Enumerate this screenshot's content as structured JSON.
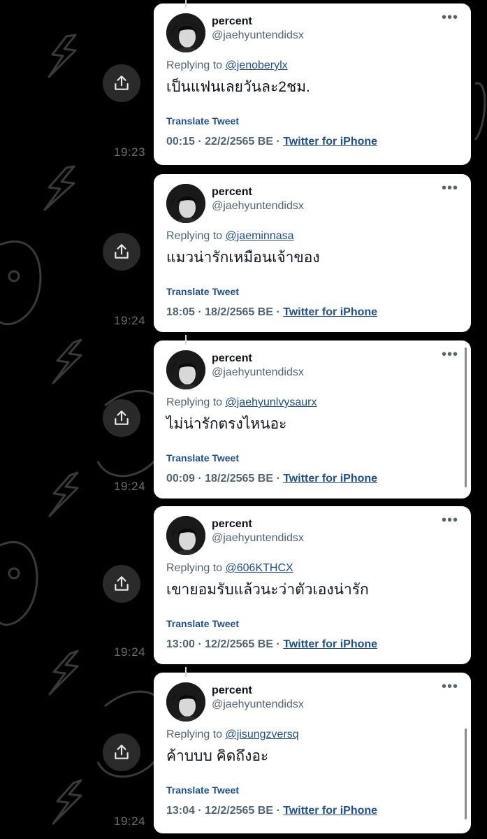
{
  "tweets": [
    {
      "display_name": "percent",
      "handle": "@jaehyuntendidsx",
      "replying_prefix": "Replying to",
      "replying_to": "@jenoberylx",
      "text": "เป็นแฟนเลยวันละ2ชม.",
      "translate": "Translate Tweet",
      "timestamp": "00:15 · 22/2/2565 BE ·",
      "source": "Twitter for iPhone",
      "side_time": "19:23"
    },
    {
      "display_name": "percent",
      "handle": "@jaehyuntendidsx",
      "replying_prefix": "Replying to",
      "replying_to": "@jaeminnasa",
      "text": "แมวน่ารักเหมือนเจ้าของ",
      "translate": "Translate Tweet",
      "timestamp": "18:05 · 18/2/2565 BE ·",
      "source": "Twitter for iPhone",
      "side_time": "19:24"
    },
    {
      "display_name": "percent",
      "handle": "@jaehyuntendidsx",
      "replying_prefix": "Replying to",
      "replying_to": "@jaehyunlvysaurx",
      "text": "ไม่น่ารักตรงไหนอะ",
      "translate": "Translate Tweet",
      "timestamp": "00:09 · 18/2/2565 BE ·",
      "source": "Twitter for iPhone",
      "side_time": "19:24"
    },
    {
      "display_name": "percent",
      "handle": "@jaehyuntendidsx",
      "replying_prefix": "Replying to",
      "replying_to": "@606KTHCX",
      "text": "เขายอมรับแล้วนะว่าตัวเองน่ารัก",
      "translate": "Translate Tweet",
      "timestamp": "13:00 · 12/2/2565 BE ·",
      "source": "Twitter for iPhone",
      "side_time": "19:24"
    },
    {
      "display_name": "percent",
      "handle": "@jaehyuntendidsx",
      "replying_prefix": "Replying to",
      "replying_to": "@jisungzversq",
      "text": "ค้าบบบ คิดถึงอะ",
      "translate": "Translate Tweet",
      "timestamp": "13:04 · 12/2/2565 BE ·",
      "source": "Twitter for iPhone",
      "side_time": "19:24"
    }
  ],
  "icons": {
    "share": "share-icon",
    "more": "more-options-icon",
    "avatar": "profile-avatar"
  },
  "colors": {
    "background": "#000000",
    "link": "#1d4f91",
    "secondary_text": "#536471"
  }
}
